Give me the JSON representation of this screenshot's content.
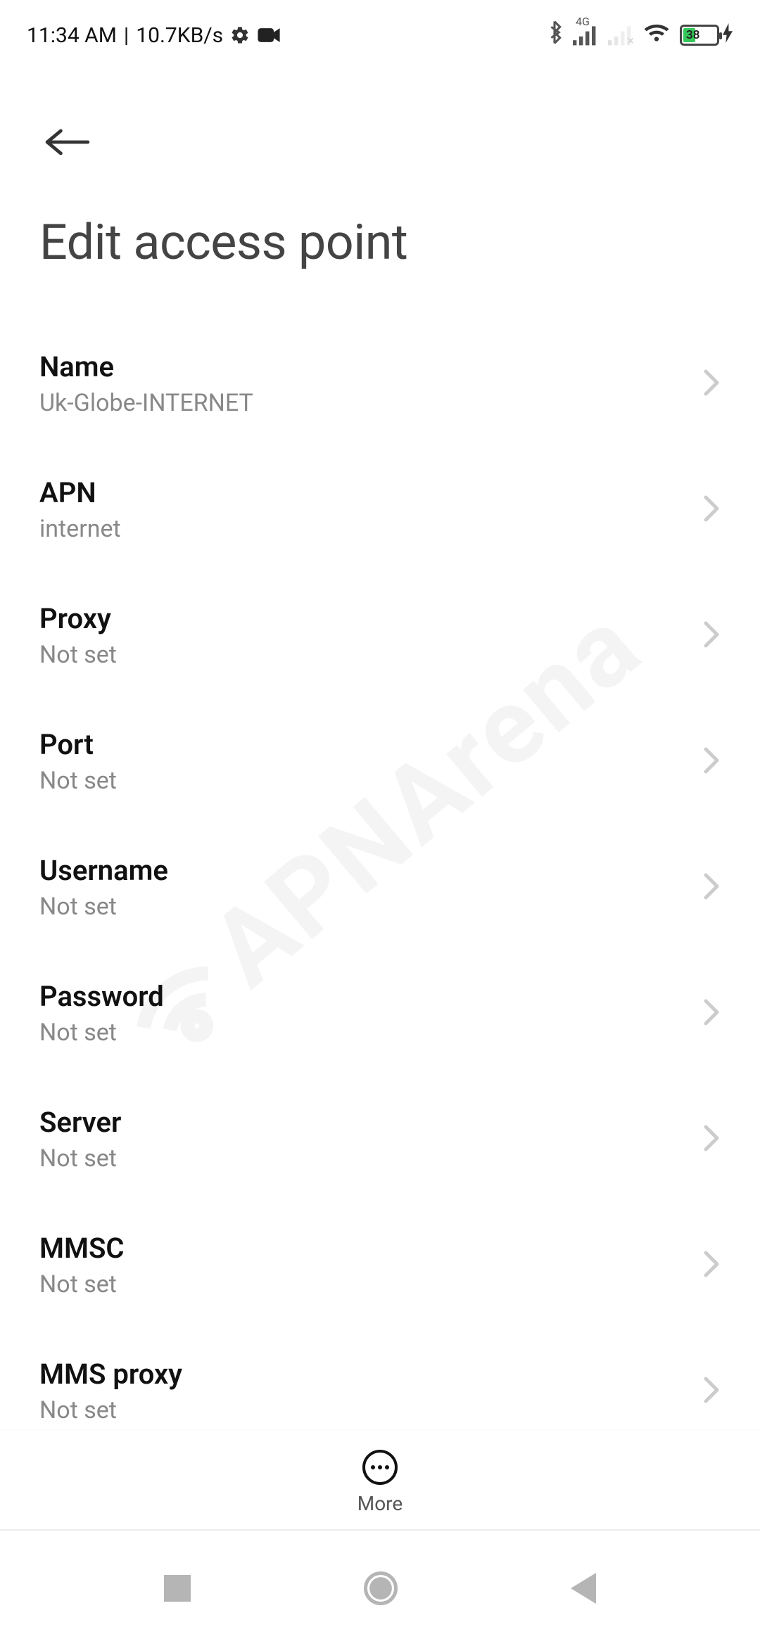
{
  "status": {
    "time": "11:34 AM",
    "net_speed": "10.7KB/s",
    "net_type": "4G",
    "battery_pct": "38"
  },
  "header": {
    "title": "Edit access point"
  },
  "settings": [
    {
      "label": "Name",
      "value": "Uk-Globe-INTERNET"
    },
    {
      "label": "APN",
      "value": "internet"
    },
    {
      "label": "Proxy",
      "value": "Not set"
    },
    {
      "label": "Port",
      "value": "Not set"
    },
    {
      "label": "Username",
      "value": "Not set"
    },
    {
      "label": "Password",
      "value": "Not set"
    },
    {
      "label": "Server",
      "value": "Not set"
    },
    {
      "label": "MMSC",
      "value": "Not set"
    },
    {
      "label": "MMS proxy",
      "value": "Not set"
    }
  ],
  "footer": {
    "more_label": "More"
  },
  "watermark": "APNArena"
}
